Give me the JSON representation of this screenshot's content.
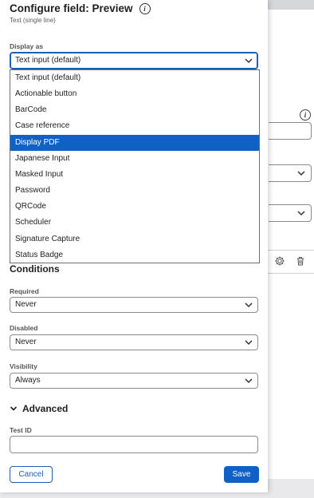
{
  "header": {
    "title": "Configure field: Preview",
    "subtitle": "Text (single line)"
  },
  "display_as": {
    "label": "Display as",
    "value": "Text input (default)",
    "options": [
      "Text input (default)",
      "Actionable button",
      "BarCode",
      "Case reference",
      "Display PDF",
      "Japanese Input",
      "Masked Input",
      "Password",
      "QRCode",
      "Scheduler",
      "Signature Capture",
      "Status Badge"
    ],
    "highlighted_option": "Display PDF"
  },
  "conditions": {
    "title": "Conditions",
    "required": {
      "label": "Required",
      "value": "Never"
    },
    "disabled": {
      "label": "Disabled",
      "value": "Never"
    },
    "visibility": {
      "label": "Visibility",
      "value": "Always"
    }
  },
  "advanced": {
    "title": "Advanced",
    "test_id": {
      "label": "Test ID",
      "value": ""
    }
  },
  "actions": {
    "cancel_label": "Cancel",
    "save_label": "Save"
  },
  "colors": {
    "accent": "#1160c6",
    "panel_bg": "#ffffff",
    "page_bg": "#e9e9eb"
  },
  "icons": [
    "info-icon",
    "chevron-down-icon",
    "gear-icon",
    "trash-icon"
  ]
}
